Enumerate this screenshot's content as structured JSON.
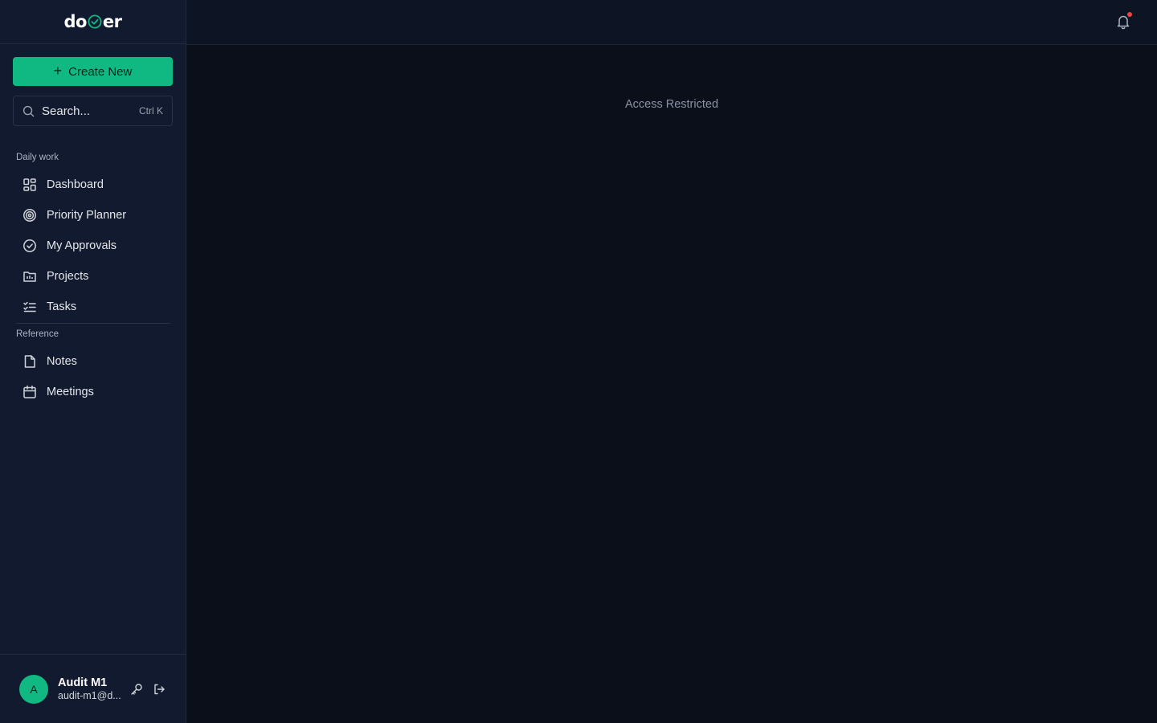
{
  "brand": {
    "logo_left": "do",
    "logo_right": "er",
    "accent": "#10b981"
  },
  "sidebar": {
    "create_label": "Create New",
    "search": {
      "placeholder": "Search...",
      "shortcut": "Ctrl K"
    },
    "sections": [
      {
        "label": "Daily work",
        "items": [
          {
            "label": "Dashboard",
            "icon": "grid-icon"
          },
          {
            "label": "Priority Planner",
            "icon": "target-icon"
          },
          {
            "label": "My Approvals",
            "icon": "check-circle-icon"
          },
          {
            "label": "Projects",
            "icon": "folder-chart-icon"
          },
          {
            "label": "Tasks",
            "icon": "list-checks-icon"
          }
        ]
      },
      {
        "label": "Reference",
        "items": [
          {
            "label": "Notes",
            "icon": "file-icon"
          },
          {
            "label": "Meetings",
            "icon": "calendar-icon"
          }
        ]
      }
    ]
  },
  "user": {
    "initial": "A",
    "name": "Audit M1",
    "email": "audit-m1@d..."
  },
  "main": {
    "message": "Access Restricted"
  },
  "notifications": {
    "status_color": "#ef4444"
  }
}
